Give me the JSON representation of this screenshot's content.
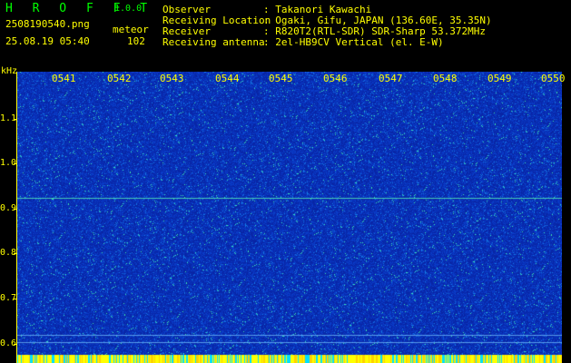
{
  "app": {
    "name": "H R O F F T",
    "version": "1.0.0"
  },
  "file": {
    "name": "2508190540.png",
    "datetime": "25.08.19 05:40",
    "type_label": "meteor",
    "count": "102"
  },
  "info": [
    {
      "key": "Observer",
      "value": ": Takanori Kawachi"
    },
    {
      "key": "Receiving Location",
      "value": ": Ogaki, Gifu, JAPAN (136.60E, 35.35N)"
    },
    {
      "key": "Receiver",
      "value": ": R820T2(RTL-SDR) SDR-Sharp 53.372MHz"
    },
    {
      "key": "Receiving antenna",
      "value": ": 2el-HB9CV Vertical (el. E-W)"
    }
  ],
  "axis": {
    "y_unit": "kHz",
    "y_ticks": [
      "1.1",
      "1.0",
      "0.9",
      "0.8",
      "0.7",
      "0.6"
    ],
    "time_ticks": [
      "0541",
      "0542",
      "0543",
      "0544",
      "0545",
      "0546",
      "0547",
      "0548",
      "0549",
      "0550"
    ]
  },
  "colors": {
    "text": "#ffff00",
    "logo": "#00ff00",
    "background": "#0b33c0",
    "marker": "#00ff80"
  }
}
